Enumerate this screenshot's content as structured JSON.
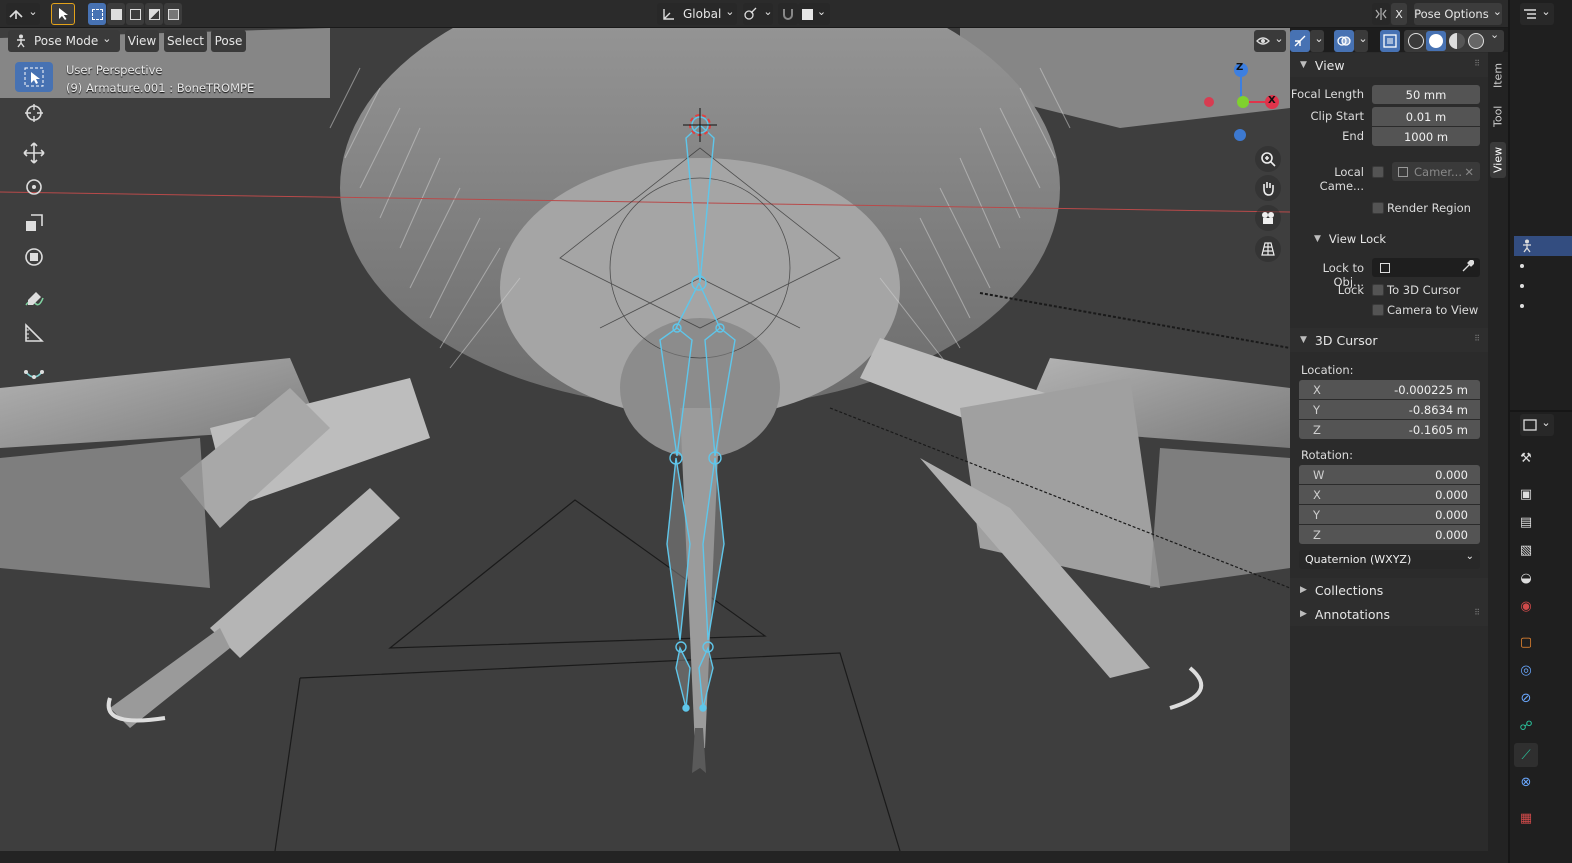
{
  "header": {
    "transform_orientation": "Global",
    "pose_options_label": "Pose Options",
    "x_mirror": "X"
  },
  "subheader": {
    "mode": "Pose Mode",
    "menus": [
      "View",
      "Select",
      "Pose"
    ]
  },
  "viewport": {
    "perspective_label": "User Perspective",
    "object_label": "(9) Armature.001 : BoneTROMPE",
    "gizmo_axes": [
      "Z",
      "X"
    ]
  },
  "npanel": {
    "view": {
      "title": "View",
      "focal_length_label": "Focal Length",
      "focal_length": "50 mm",
      "clip_start_label": "Clip Start",
      "clip_start": "0.01 m",
      "clip_end_label": "End",
      "clip_end": "1000 m",
      "local_camera_label": "Local Came...",
      "local_camera_value": "Camer...",
      "render_region_label": "Render Region"
    },
    "view_lock": {
      "title": "View Lock",
      "lock_to_object_label": "Lock to Obj...",
      "lock_label": "Lock",
      "to_3d_cursor_label": "To 3D Cursor",
      "camera_to_view_label": "Camera to View"
    },
    "cursor": {
      "title": "3D Cursor",
      "location_label": "Location:",
      "location": [
        {
          "axis": "X",
          "value": "-0.000225 m"
        },
        {
          "axis": "Y",
          "value": "-0.8634 m"
        },
        {
          "axis": "Z",
          "value": "-0.1605 m"
        }
      ],
      "rotation_label": "Rotation:",
      "rotation": [
        {
          "axis": "W",
          "value": "0.000"
        },
        {
          "axis": "X",
          "value": "0.000"
        },
        {
          "axis": "Y",
          "value": "0.000"
        },
        {
          "axis": "Z",
          "value": "0.000"
        }
      ],
      "rotation_mode": "Quaternion (WXYZ)"
    },
    "collections_title": "Collections",
    "annotations_title": "Annotations"
  },
  "sidetabs": [
    "Item",
    "Tool",
    "View"
  ],
  "colors": {
    "accent": "#4772b3",
    "bone": "#5fc6ea",
    "x_axis": "#e0344b",
    "y_axis": "#7fd12e",
    "z_axis": "#3d7fe0",
    "viewport_bg": "#3d3d3d",
    "panel_bg": "#2b2b2b"
  }
}
